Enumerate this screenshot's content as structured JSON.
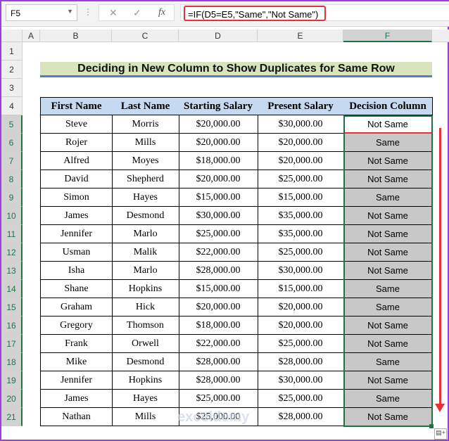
{
  "formula_bar": {
    "name_box": "F5",
    "cancel_icon": "✕",
    "enter_icon": "✓",
    "fx_label": "fx",
    "formula": "=IF(D5=E5,\"Same\",\"Not Same\")"
  },
  "columns": [
    "A",
    "B",
    "C",
    "D",
    "E",
    "F"
  ],
  "rows": [
    "1",
    "2",
    "3",
    "4",
    "5",
    "6",
    "7",
    "8",
    "9",
    "10",
    "11",
    "12",
    "13",
    "14",
    "15",
    "16",
    "17",
    "18",
    "19",
    "20",
    "21"
  ],
  "title": "Deciding in New Column to Show Duplicates for Same Row",
  "table": {
    "headers": [
      "First Name",
      "Last Name",
      "Starting Salary",
      "Present Salary",
      "Decision Column"
    ],
    "rows": [
      [
        "Steve",
        "Morris",
        "$20,000.00",
        "$30,000.00",
        "Not Same"
      ],
      [
        "Rojer",
        "Mills",
        "$20,000.00",
        "$20,000.00",
        "Same"
      ],
      [
        "Alfred",
        "Moyes",
        "$18,000.00",
        "$20,000.00",
        "Not Same"
      ],
      [
        "David",
        "Shepherd",
        "$20,000.00",
        "$25,000.00",
        "Not Same"
      ],
      [
        "Simon",
        "Hayes",
        "$15,000.00",
        "$15,000.00",
        "Same"
      ],
      [
        "James",
        "Desmond",
        "$30,000.00",
        "$35,000.00",
        "Not Same"
      ],
      [
        "Jennifer",
        "Marlo",
        "$25,000.00",
        "$35,000.00",
        "Not Same"
      ],
      [
        "Usman",
        "Malik",
        "$22,000.00",
        "$25,000.00",
        "Not Same"
      ],
      [
        "Isha",
        "Marlo",
        "$28,000.00",
        "$30,000.00",
        "Not Same"
      ],
      [
        "Shane",
        "Hopkins",
        "$15,000.00",
        "$15,000.00",
        "Same"
      ],
      [
        "Graham",
        "Hick",
        "$20,000.00",
        "$20,000.00",
        "Same"
      ],
      [
        "Gregory",
        "Thomson",
        "$18,000.00",
        "$20,000.00",
        "Not Same"
      ],
      [
        "Frank",
        "Orwell",
        "$22,000.00",
        "$25,000.00",
        "Not Same"
      ],
      [
        "Mike",
        "Desmond",
        "$28,000.00",
        "$28,000.00",
        "Same"
      ],
      [
        "Jennifer",
        "Hopkins",
        "$28,000.00",
        "$30,000.00",
        "Not Same"
      ],
      [
        "James",
        "Hayes",
        "$25,000.00",
        "$25,000.00",
        "Same"
      ],
      [
        "Nathan",
        "Mills",
        "$25,000.00",
        "$28,000.00",
        "Not Same"
      ]
    ]
  },
  "watermark": "exceldemy"
}
